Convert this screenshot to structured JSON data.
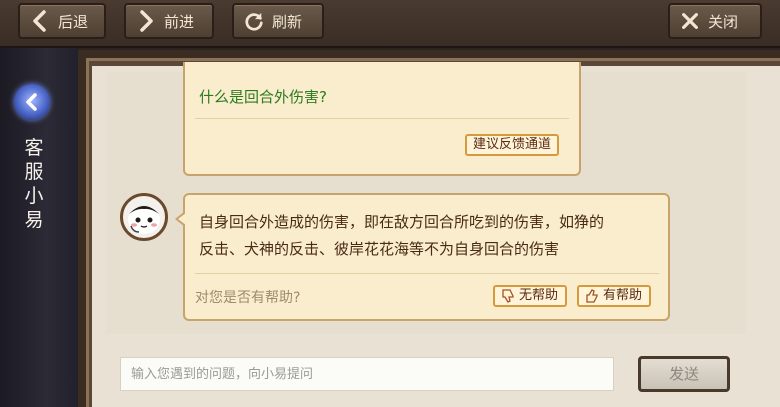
{
  "toolbar": {
    "back_label": "后退",
    "forward_label": "前进",
    "refresh_label": "刷新",
    "close_label": "关闭"
  },
  "sidebar": {
    "title_chars": [
      "客",
      "服",
      "小",
      "易"
    ]
  },
  "chat": {
    "question_link": "什么是回合外伤害?",
    "feedback_button": "建议反馈通道",
    "answer_line1": "自身回合外造成的伤害，即在敌方回合所吃到的伤害，如狰的",
    "answer_line2": "反击、犬神的反击、彼岸花花海等不为自身回合的伤害",
    "helpful_question": "对您是否有帮助?",
    "not_helpful_label": "无帮助",
    "helpful_label": "有帮助"
  },
  "input": {
    "placeholder": "输入您遇到的问题，向小易提问",
    "value": ""
  },
  "send_label": "发送",
  "colors": {
    "bubble_bg": "#f9edcd",
    "bubble_border": "#c9a46a",
    "link_green": "#2b7a1e",
    "panel_bg": "#e9e2d4"
  }
}
